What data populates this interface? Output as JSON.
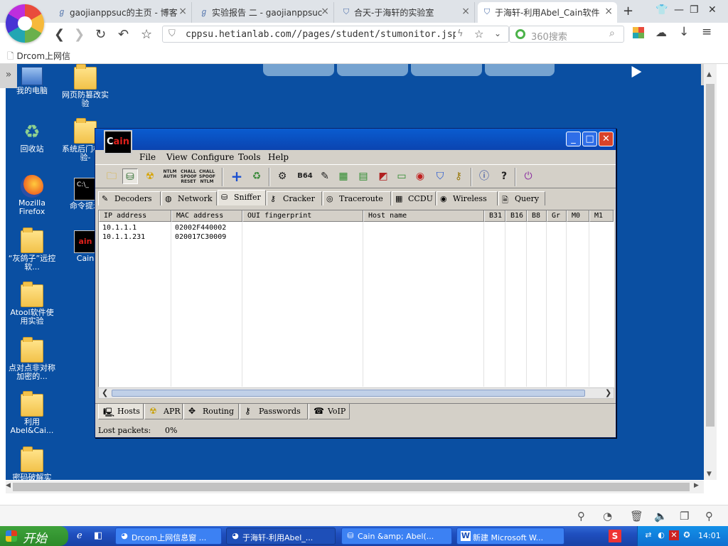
{
  "browser": {
    "tabs": [
      {
        "title": "gaojianppsuc的主页 - 博客",
        "icon": "hook-icon"
      },
      {
        "title": "实验报告 二 - gaojianppsuc",
        "icon": "hook-icon"
      },
      {
        "title": "合天-于海轩的实验室",
        "icon": "shield-icon"
      },
      {
        "title": "于海轩-利用Abel_Cain软件",
        "icon": "shield-icon"
      }
    ],
    "new_tab": "+",
    "url": "cppsu.hetianlab.com//pages/student/stumonitor.jsp",
    "search_placeholder": "360搜索",
    "bookmark": "Drcom上网信"
  },
  "desktop": {
    "icons": [
      {
        "label": "我的电脑",
        "icon": "computer-icon"
      },
      {
        "label": "网页防篡改实验",
        "icon": "folder-icon"
      },
      {
        "label": "回收站",
        "icon": "recycle-bin-icon"
      },
      {
        "label": "系统后门植实验-",
        "icon": "folder-icon"
      },
      {
        "label": "Mozilla Firefox",
        "icon": "firefox-icon"
      },
      {
        "label": "命令提示",
        "icon": "cmd-icon"
      },
      {
        "label": "“灰鸽子”远控软...",
        "icon": "folder-icon"
      },
      {
        "label": "Cain",
        "icon": "cain-icon"
      },
      {
        "label": "Atool软件使用实验",
        "icon": "folder-icon"
      },
      {
        "label": "点对点非对称加密的...",
        "icon": "folder-icon"
      },
      {
        "label": "利用 Abel&Cai...",
        "icon": "folder-icon"
      },
      {
        "label": "密码破解实",
        "icon": "folder-icon"
      }
    ],
    "cmd_icon_text": "C:\\_"
  },
  "cain": {
    "logo_text_a": "C",
    "logo_text_b": "ain",
    "menu": [
      "File",
      "View",
      "Configure",
      "Tools",
      "Help"
    ],
    "toolbar_text": {
      "ntlm_auth": "NTLM AUTH",
      "chall_spoof": "CHALL SPOOF RESET",
      "chall_ntlm": "CHALL SPOOF NTLM",
      "b64": "B64"
    },
    "tabs": [
      "Decoders",
      "Network",
      "Sniffer",
      "Cracker",
      "Traceroute",
      "CCDU",
      "Wireless",
      "Query"
    ],
    "active_tab": "Sniffer",
    "columns": [
      "IP address",
      "MAC address",
      "OUI fingerprint",
      "Host name",
      "B31",
      "B16",
      "B8",
      "Gr",
      "M0",
      "M1"
    ],
    "rows": [
      {
        "ip": "10.1.1.1",
        "mac": "02002F440002",
        "oui": "",
        "host": ""
      },
      {
        "ip": "10.1.1.231",
        "mac": "020017C30009",
        "oui": "",
        "host": ""
      }
    ],
    "bottom_tabs": [
      "Hosts",
      "APR",
      "Routing",
      "Passwords",
      "VoIP"
    ],
    "active_bottom_tab": "Hosts",
    "status_label": "Lost packets:",
    "status_value": "0%"
  },
  "taskbar": {
    "start": "开始",
    "items": [
      {
        "label": "Drcom上网信息窗 ...",
        "icon": "browser-icon"
      },
      {
        "label": "于海轩-利用Abel_...",
        "icon": "browser-icon"
      },
      {
        "label": "Cain &amp; Abel(...",
        "icon": "cain-icon"
      },
      {
        "label": "新建 Microsoft W...",
        "icon": "word-icon"
      }
    ],
    "ime": "S",
    "clock": "14:01"
  },
  "colors": {
    "desktop_bg": "#0a4fa2",
    "xp_title": "#0a5cd0",
    "taskbar": "#2456c9"
  }
}
